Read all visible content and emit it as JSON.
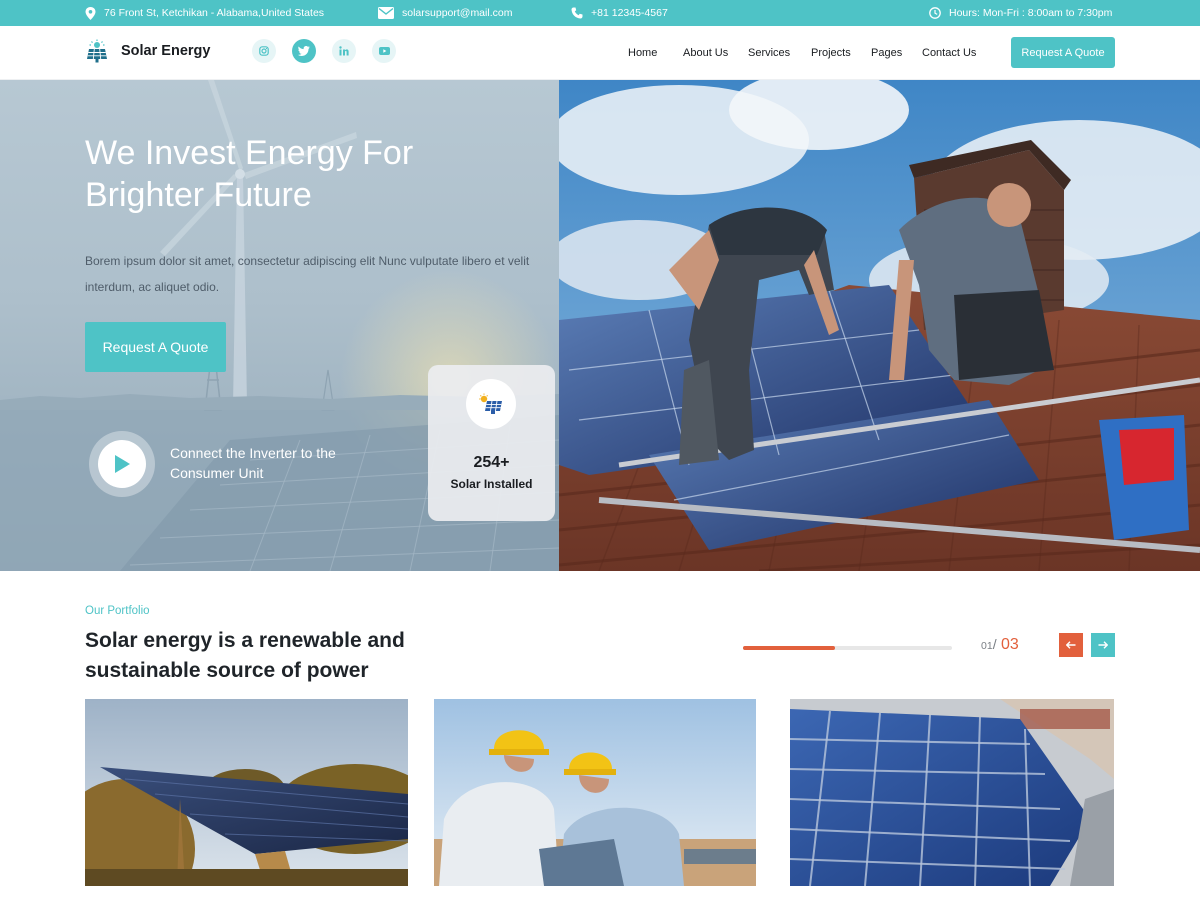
{
  "topbar": {
    "address": "76 Front St, Ketchikan - Alabama,United States",
    "email": "solarsupport@mail.com",
    "phone": "+81 12345-4567",
    "hours": "Hours: Mon-Fri : 8:00am to 7:30pm"
  },
  "nav": {
    "brand": "Solar Energy",
    "social": [
      "instagram-icon",
      "twitter-icon",
      "linkedin-icon",
      "youtube-icon"
    ],
    "menu": [
      "Home",
      "About Us",
      "Services",
      "Projects",
      "Pages",
      "Contact Us"
    ],
    "cta": "Request A Quote"
  },
  "hero": {
    "title": "We Invest Energy For Brighter Future",
    "text": "Borem ipsum dolor sit amet, consectetur adipiscing elit Nunc vulputate libero et velit interdum, ac aliquet odio.",
    "cta": "Request A Quote",
    "video_label": "Connect the Inverter to the Consumer Unit",
    "stat_value": "254+",
    "stat_label": "Solar Installed"
  },
  "portfolio": {
    "eyebrow": "Our Portfolio",
    "title": "Solar energy is a renewable and sustainable source of power",
    "slider": {
      "current": "01",
      "separator": "/",
      "total": "03",
      "progress": 0.44
    }
  },
  "colors": {
    "accent": "#4ec3c6",
    "highlight": "#e2603c",
    "dark": "#1a1d21"
  }
}
